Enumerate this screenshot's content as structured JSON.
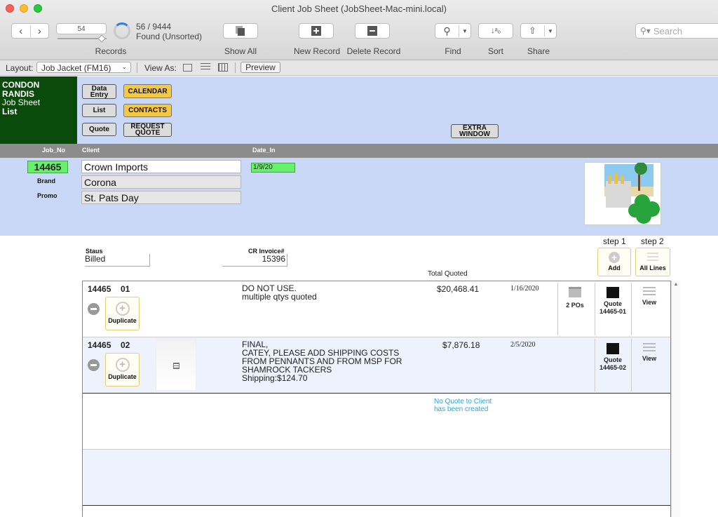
{
  "window": {
    "title": "Client Job Sheet (JobSheet-Mac-mini.local)"
  },
  "toolbar": {
    "record_number": "54",
    "found_count": "56 / 9444",
    "found_state": "Found (Unsorted)",
    "records_label": "Records",
    "show_all_label": "Show All",
    "new_record_label": "New Record",
    "delete_record_label": "Delete Record",
    "find_label": "Find",
    "sort_label": "Sort",
    "share_label": "Share",
    "search_placeholder": "Search"
  },
  "layout_bar": {
    "layout_label": "Layout:",
    "layout_value": "Job Jacket (FM16)",
    "view_as_label": "View As:",
    "preview_label": "Preview"
  },
  "logo": {
    "line1": "CONDON",
    "line2": "RANDIS",
    "line3": "Job Sheet",
    "line4": "List"
  },
  "nav_buttons": {
    "data_entry": "Data Entry",
    "list": "List",
    "quote": "Quote",
    "calendar": "CALENDAR",
    "contacts": "CONTACTS",
    "request_quote": "REQUEST QUOTE",
    "extra_window": "EXTRA WINDOW"
  },
  "columns": {
    "job_no": "Job_No",
    "client": "Client",
    "date_in": "Date_In"
  },
  "job": {
    "job_no": "14465",
    "client": "Crown Imports",
    "date_in": "1/9/20",
    "brand_label": "Brand",
    "brand": "Corona",
    "promo_label": "Promo",
    "promo": "St. Pats Day"
  },
  "status": {
    "status_label": "Staus",
    "status_value": "Billed",
    "invoice_label": "CR Invoice#",
    "invoice_value": "15396",
    "total_quoted_label": "Total Quoted"
  },
  "steps": {
    "step1": "step 1",
    "step2": "step 2",
    "add_label": "Add",
    "all_lines_label": "All Lines"
  },
  "quotes": [
    {
      "job": "14465",
      "line": "01",
      "description": "DO NOT USE.\nmultiple qtys quoted",
      "amount": "$20,468.41",
      "date": "1/16/2020",
      "pos": "2 POs",
      "quote_label": "Quote",
      "quote_id": "14465-01",
      "view_label": "View",
      "duplicate_label": "Duplicate"
    },
    {
      "job": "14465",
      "line": "02",
      "description": "FINAL,\nCATEY, PLEASE ADD SHIPPING COSTS\nFROM PENNANTS AND FROM MSP FOR\nSHAMROCK TACKERS\nShipping:$124.70",
      "amount": "$7,876.18",
      "date": "2/5/2020",
      "quote_label": "Quote",
      "quote_id": "14465-02",
      "view_label": "View",
      "duplicate_label": "Duplicate"
    }
  ],
  "notice": {
    "line1": "No Quote to Client",
    "line2": "has been created"
  },
  "colors": {
    "header_bg": "#c9d8f7",
    "logo_bg": "#0a4a0a",
    "job_no_bg": "#66f06b",
    "yellow_btn": "#f5c842",
    "notice_text": "#27a8e0"
  }
}
